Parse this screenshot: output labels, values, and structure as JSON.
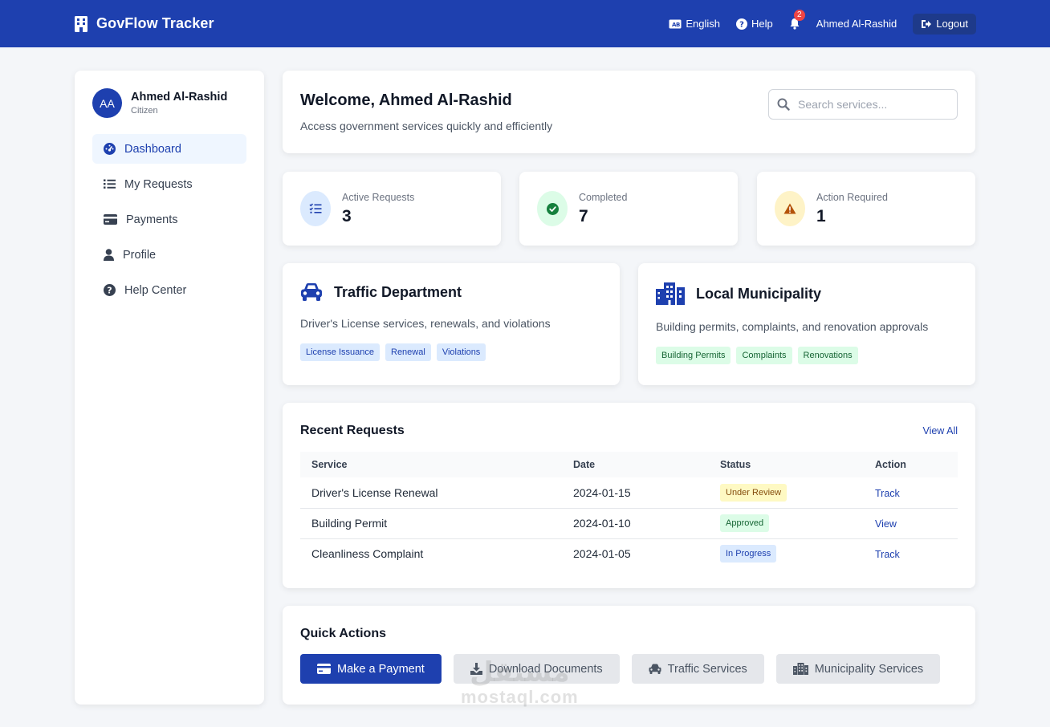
{
  "header": {
    "brand_name": "GovFlow Tracker",
    "language_label": "English",
    "help_label": "Help",
    "notification_count": "2",
    "user_name": "Ahmed Al-Rashid",
    "logout_label": "Logout",
    "colors": {
      "bar": "#1e40af",
      "badge": "#ef4444"
    }
  },
  "sidebar": {
    "avatar_initials": "AA",
    "user_name": "Ahmed Al-Rashid",
    "user_role": "Citizen",
    "items": [
      {
        "label": "Dashboard",
        "icon": "dashboard-icon",
        "active": true
      },
      {
        "label": "My Requests",
        "icon": "list-icon"
      },
      {
        "label": "Payments",
        "icon": "credit-card-icon"
      },
      {
        "label": "Profile",
        "icon": "user-icon"
      },
      {
        "label": "Help Center",
        "icon": "question-circle-icon"
      }
    ]
  },
  "welcome": {
    "title": "Welcome, Ahmed Al-Rashid",
    "subtitle": "Access government services quickly and efficiently",
    "search_placeholder": "Search services..."
  },
  "stats": [
    {
      "label": "Active Requests",
      "value": "3",
      "icon": "tasks-icon",
      "color": "#dbeafe"
    },
    {
      "label": "Completed",
      "value": "7",
      "icon": "check-circle-icon",
      "color": "#dcfce7"
    },
    {
      "label": "Action Required",
      "value": "1",
      "icon": "warning-icon",
      "color": "#fef3c7"
    }
  ],
  "departments": [
    {
      "title": "Traffic Department",
      "description": "Driver's License services, renewals, and violations",
      "icon": "car-icon",
      "tags": [
        "License Issuance",
        "Renewal",
        "Violations"
      ]
    },
    {
      "title": "Local Municipality",
      "description": "Building permits, complaints, and renovation approvals",
      "icon": "city-icon",
      "tags": [
        "Building Permits",
        "Complaints",
        "Renovations"
      ]
    }
  ],
  "recent": {
    "title": "Recent Requests",
    "view_all": "View All",
    "columns": [
      "Service",
      "Date",
      "Status",
      "Action"
    ],
    "rows": [
      {
        "service": "Driver's License Renewal",
        "date": "2024-01-15",
        "status": "Under Review",
        "action": "Track"
      },
      {
        "service": "Building Permit",
        "date": "2024-01-10",
        "status": "Approved",
        "action": "View"
      },
      {
        "service": "Cleanliness Complaint",
        "date": "2024-01-05",
        "status": "In Progress",
        "action": "Track"
      }
    ],
    "status_colors": {
      "under_review": {
        "bg": "#fef9c3",
        "fg": "#854d0e"
      },
      "approved": {
        "bg": "#dcfce7",
        "fg": "#166534"
      },
      "in_progress": {
        "bg": "#dbeafe",
        "fg": "#1e40af"
      }
    }
  },
  "quick_actions": {
    "title": "Quick Actions",
    "buttons": [
      {
        "label": "Make a Payment",
        "icon": "credit-card-icon",
        "primary": true
      },
      {
        "label": "Download Documents",
        "icon": "download-icon"
      },
      {
        "label": "Traffic Services",
        "icon": "car-icon"
      },
      {
        "label": "Municipality Services",
        "icon": "city-icon"
      }
    ]
  },
  "watermark": {
    "arabic": "مستقل",
    "latin": "mostaql.com"
  }
}
